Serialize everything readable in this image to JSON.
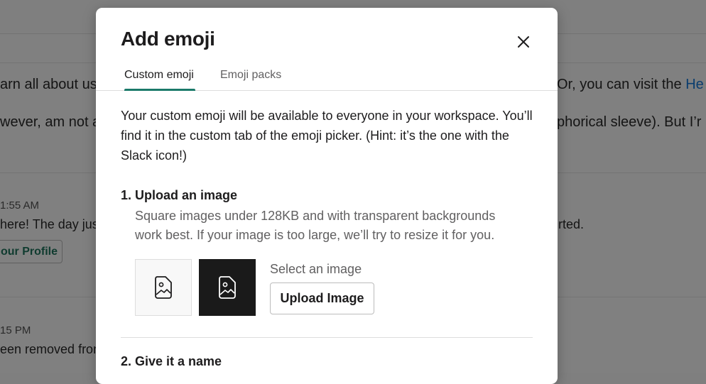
{
  "background": {
    "line1_left": "arn all about us",
    "line1_right_prefix": "Or, you can visit the ",
    "line1_right_link": "He",
    "line2_left": "wever, am not a",
    "line2_right": "phorical sleeve). But I’r",
    "msg1_time": "1:55 AM",
    "msg1_text_left": "here! The day just",
    "msg1_text_right": "rted.",
    "msg1_button": "our Profile",
    "msg2_time": "15 PM",
    "msg2_text": "een removed fron"
  },
  "modal": {
    "title": "Add emoji",
    "tabs": [
      {
        "label": "Custom emoji",
        "active": true
      },
      {
        "label": "Emoji packs",
        "active": false
      }
    ],
    "intro": "Your custom emoji will be available to everyone in your workspace. You’ll find it in the custom tab of the emoji picker. (Hint: it’s the one with the Slack icon!)",
    "step1": {
      "title": "1. Upload an image",
      "hint": "Square images under 128KB and with transparent backgrounds work best. If your image is too large, we’ll try to resize it for you.",
      "select_label": "Select an image",
      "upload_button": "Upload Image"
    },
    "step2": {
      "title": "2. Give it a name"
    }
  },
  "colors": {
    "accent": "#1b7a6a",
    "overlay": "#808080",
    "text_primary": "#1d1c1d",
    "text_secondary": "#616061"
  },
  "icons": {
    "close": "close-icon",
    "image_placeholder": "image-file-icon"
  }
}
